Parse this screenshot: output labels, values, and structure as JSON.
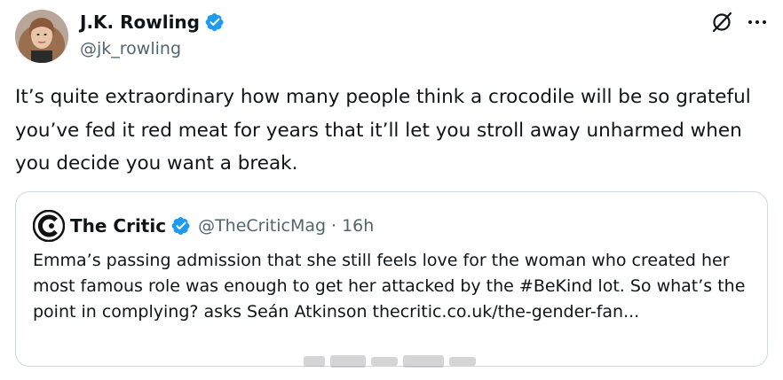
{
  "post": {
    "author_name": "J.K. Rowling",
    "author_handle": "@jk_rowling",
    "text": "It’s quite extraordinary how many people think a crocodile will be so grateful you’ve fed it red meat for years that it’ll let you stroll away unharmed when you decide you want a break."
  },
  "quote": {
    "name": "The Critic",
    "handle": "@TheCriticMag",
    "separator": "·",
    "time": "16h",
    "text": "Emma’s passing admission that she still feels love for the woman who created her most famous role was enough to get her attacked by the #BeKind lot. So what’s the point in complying? asks Seán Atkinson thecritic.co.uk/the-gender-fan..."
  },
  "icons": {
    "verified": "verified-badge-icon",
    "grok": "grok-icon",
    "more": "more-icon",
    "critic_logo": "the-critic-logo"
  },
  "colors": {
    "verified_blue": "#1d9bf0",
    "text_primary": "#0f1419",
    "text_secondary": "#536471",
    "card_border": "#cfd9de"
  }
}
